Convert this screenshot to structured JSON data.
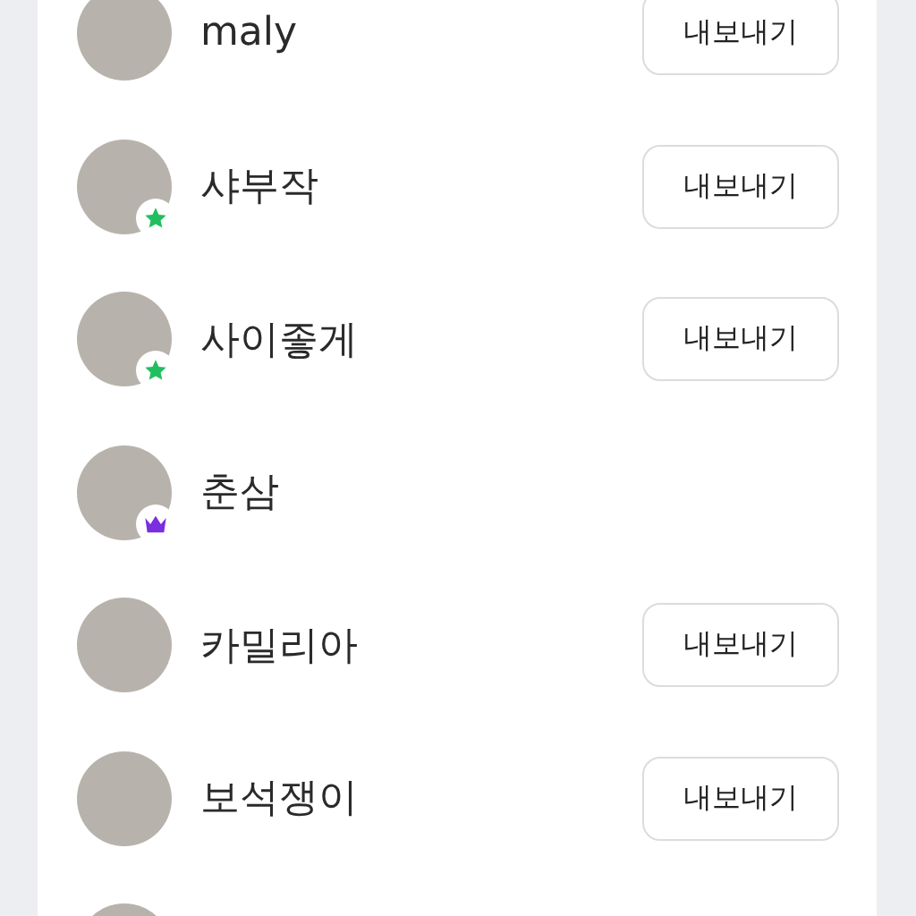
{
  "friends": [
    {
      "kind": "friend",
      "name": "maly",
      "button": "내보내기"
    },
    {
      "kind": "friend",
      "name": "샤부작",
      "badge": {
        "kind": "star"
      },
      "button": "내보내기"
    },
    {
      "kind": "friend",
      "name": "사이좋게",
      "badge": {
        "kind": "star"
      },
      "button": "내보내기"
    },
    {
      "kind": "friend",
      "name": "춘삼",
      "badge": {
        "kind": "crown"
      }
    },
    {
      "kind": "friend",
      "name": "카밀리아",
      "button": "내보내기"
    },
    {
      "kind": "friend",
      "name": "보석쟁이",
      "button": "내보내기"
    },
    {
      "kind": "cut_off"
    }
  ]
}
